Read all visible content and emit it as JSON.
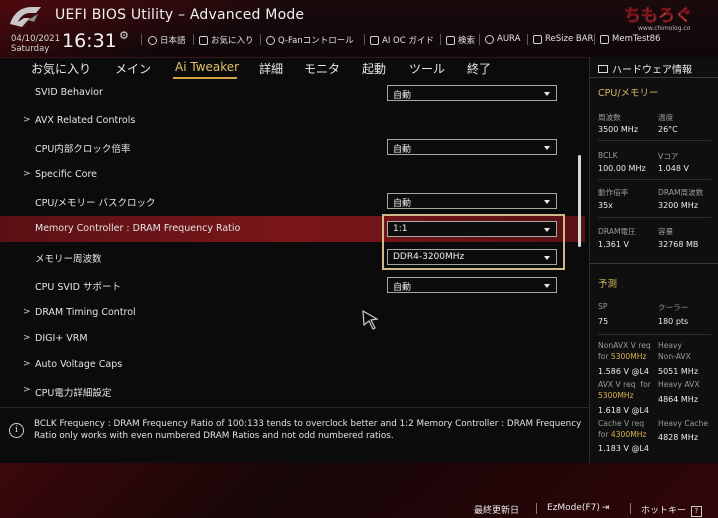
{
  "header": {
    "title": "UEFI BIOS Utility – Advanced Mode",
    "date": "04/10/2021",
    "weekday": "Saturday",
    "time": "16:31",
    "watermark_text": "ちもろぐ",
    "watermark_url": "www.chimolog.co",
    "toolbar": [
      {
        "name": "language",
        "icon": "globe-icon",
        "label": "日本語"
      },
      {
        "name": "favorites",
        "icon": "bookmark-icon",
        "label": "お気に入り"
      },
      {
        "name": "qfan",
        "icon": "fan-icon",
        "label": "Q-Fanコントロール"
      },
      {
        "name": "ai-oc-guide",
        "icon": "ai-icon",
        "label": "AI OC ガイド"
      },
      {
        "name": "search",
        "icon": "search-icon",
        "label": "検索"
      },
      {
        "name": "aura",
        "icon": "aura-icon",
        "label": "AURA"
      },
      {
        "name": "resize-bar",
        "icon": "resize-icon",
        "label": "ReSize BAR"
      },
      {
        "name": "memtest",
        "icon": "memory-icon",
        "label": "MemTest86"
      }
    ]
  },
  "tabs": [
    {
      "label": "お気に入り"
    },
    {
      "label": "メイン"
    },
    {
      "label": "Ai Tweaker",
      "active": true
    },
    {
      "label": "詳細"
    },
    {
      "label": "モニタ"
    },
    {
      "label": "起動"
    },
    {
      "label": "ツール"
    },
    {
      "label": "終了"
    }
  ],
  "settings": [
    {
      "label": "SVID Behavior",
      "value": "自動"
    },
    {
      "label": "AVX Related Controls",
      "submenu": true
    },
    {
      "label": "CPU内部クロック倍率",
      "value": "自動"
    },
    {
      "label": "Specific Core",
      "submenu": true
    },
    {
      "label": "CPU/メモリー バスクロック",
      "value": "自動"
    },
    {
      "label": "Memory Controller : DRAM Frequency Ratio",
      "value": "1:1",
      "highlighted": true
    },
    {
      "label": "メモリー周波数",
      "value": "DDR4-3200MHz"
    },
    {
      "label": "CPU SVID サポート",
      "value": "自動"
    },
    {
      "label": "DRAM Timing Control",
      "submenu": true
    },
    {
      "label": "DIGI+ VRM",
      "submenu": true
    },
    {
      "label": "Auto Voltage Caps",
      "submenu": true
    },
    {
      "label": "CPU電力詳細設定",
      "submenu": true
    }
  ],
  "help": {
    "text": "BCLK Frequency : DRAM Frequency Ratio of 100:133 tends to overclock better and 1:2 Memory Controller : DRAM Frequency Ratio only works with even numbered DRAM Ratios and not odd numbered ratios."
  },
  "hardware_monitor": {
    "title": "ハードウェア情報",
    "cpu_memory": {
      "heading": "CPU/メモリー",
      "freq_label": "周波数",
      "freq_value": "3500 MHz",
      "temp_label": "温度",
      "temp_value": "26°C",
      "bclk_label": "BCLK",
      "bclk_value": "100.00 MHz",
      "vcore_label": "Vコア",
      "vcore_value": "1.048 V",
      "ratio_label": "動作倍率",
      "ratio_value": "35x",
      "dram_freq_label": "DRAM周波数",
      "dram_freq_value": "3200 MHz",
      "dram_volt_label": "DRAM電圧",
      "dram_volt_value": "1.361 V",
      "capacity_label": "容量",
      "capacity_value": "32768 MB"
    },
    "prediction": {
      "heading": "予測",
      "sp_label": "SP",
      "sp_value": "75",
      "cooler_label": "クーラー",
      "cooler_value": "180 pts",
      "nonavx_label": "NonAVX V req",
      "nonavx_for": "for",
      "nonavx_freq": "5300MHz",
      "nonavx_value": "1.586 V @L4",
      "heavy_nonavx_label": "Heavy",
      "heavy_nonavx_sub": "Non-AVX",
      "heavy_nonavx_value": "5051 MHz",
      "avx_label": "AVX V req",
      "avx_for": "for",
      "avx_freq": "5300MHz",
      "avx_value": "1.618 V @L4",
      "heavy_avx_label": "Heavy AVX",
      "heavy_avx_value": "4864 MHz",
      "cache_label": "Cache V req",
      "cache_for": "for",
      "cache_freq": "4300MHz",
      "cache_value": "1.183 V @L4",
      "heavy_cache_label": "Heavy Cache",
      "heavy_cache_value": "4828 MHz"
    }
  },
  "footer": {
    "last_modified": "最終更新日",
    "ezmode": "EzMode(F7)",
    "hotkeys": "ホットキー",
    "hotkey_glyph": "?"
  },
  "colors": {
    "accent_gold": "#d4a648",
    "highlight_red": "#7a161a",
    "prediction_yellow": "#d9b24c"
  }
}
